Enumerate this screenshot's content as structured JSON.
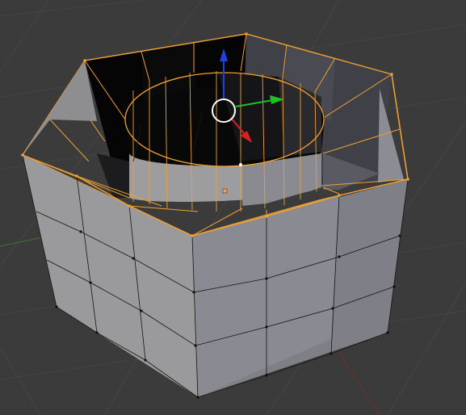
{
  "viewport": {
    "mode": "edit-mode",
    "object": "hexagonal-nut-mesh",
    "colors": {
      "background": "#3b3b3b",
      "grid_line": "#454545",
      "x_axis_line": "#6e2e2e",
      "y_axis_line": "#3e6a2e",
      "face_light": "#9b9b9e",
      "face_mid": "#8a8a90",
      "face_dark": "#6e6e76",
      "face_shadow": "#2c2c2e",
      "face_black": "#050505",
      "selection_edge": "#f0a030",
      "wire": "#101010",
      "active_vertex": "#ffffff",
      "origin_dot": "#f0a060",
      "gizmo_x": "#e02020",
      "gizmo_y": "#20c020",
      "gizmo_z": "#2040e0",
      "gizmo_ring": "#ffffff"
    }
  },
  "gizmo": {
    "x_icon": "arrow-red-icon",
    "y_icon": "arrow-green-icon",
    "z_icon": "arrow-blue-icon",
    "center_icon": "cursor-ring-icon"
  }
}
